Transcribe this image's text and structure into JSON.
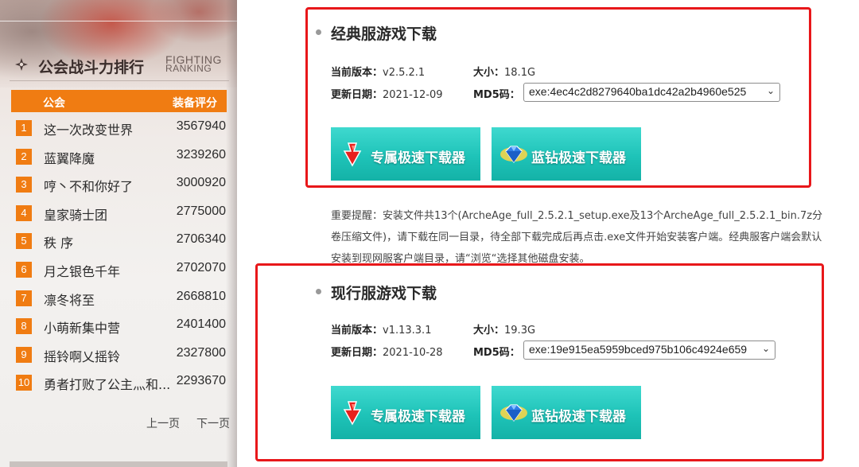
{
  "ranking": {
    "title": "公会战斗力排行",
    "title_en_1": "FIGHTING",
    "title_en_2": "RANKING",
    "col_guild": "公会",
    "col_score": "装备评分",
    "rows": [
      {
        "rank": "1",
        "name": "这一次改变世界",
        "score": "3567940"
      },
      {
        "rank": "2",
        "name": "蓝翼降魔",
        "score": "3239260"
      },
      {
        "rank": "3",
        "name": "哼丶不和你好了",
        "score": "3000920"
      },
      {
        "rank": "4",
        "name": "皇家骑士团",
        "score": "2775000"
      },
      {
        "rank": "5",
        "name": "秩 序",
        "score": "2706340"
      },
      {
        "rank": "6",
        "name": "月之银色千年",
        "score": "2702070"
      },
      {
        "rank": "7",
        "name": "凛冬将至",
        "score": "2668810"
      },
      {
        "rank": "8",
        "name": "小萌新集中营",
        "score": "2401400"
      },
      {
        "rank": "9",
        "name": "摇铃啊乂摇铃",
        "score": "2327800"
      },
      {
        "rank": "10",
        "name": "勇者打败了公主灬和...",
        "score": "2293670"
      }
    ],
    "prev_label": "上一页",
    "next_label": "下一页",
    "accent": "#f07c12"
  },
  "classic": {
    "title": "经典服游戏下载",
    "version_label": "当前版本：",
    "version": "v2.5.2.1",
    "size_label": "大小：",
    "size": "18.1G",
    "date_label": "更新日期：",
    "date": "2021-12-09",
    "md5_label": "MD5码：",
    "md5": "exe:4ec4c2d8279640ba1dc42a2b4960e525",
    "btn_exclusive": "专属极速下载器",
    "btn_diamond": "蓝钻极速下载器"
  },
  "notice": "重要提醒：安装文件共13个(ArcheAge_full_2.5.2.1_setup.exe及13个ArcheAge_full_2.5.2.1_bin.7z分卷压缩文件)，请下载在同一目录，待全部下载完成后再点击.exe文件开始安装客户端。经典服客户端会默认安装到现网服客户端目录，请“浏览“选择其他磁盘安装。",
  "current": {
    "title": "现行服游戏下载",
    "version_label": "当前版本：",
    "version": "v1.13.3.1",
    "size_label": "大小：",
    "size": "19.3G",
    "date_label": "更新日期：",
    "date": "2021-10-28",
    "md5_label": "MD5码：",
    "md5": "exe:19e915ea5959bced975b106c4924e659",
    "btn_exclusive": "专属极速下载器",
    "btn_diamond": "蓝钻极速下载器"
  },
  "colors": {
    "highlight_border": "#e8171a",
    "button_teal": "#1ec3b8"
  }
}
